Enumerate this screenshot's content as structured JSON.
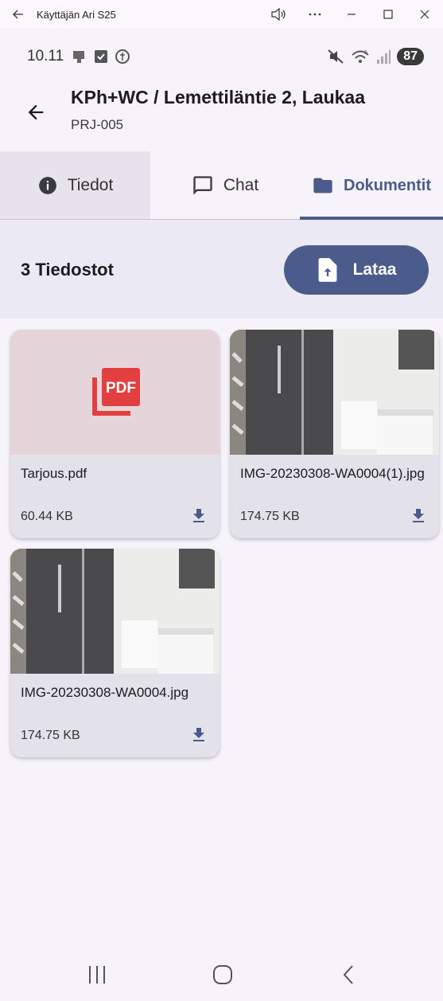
{
  "window": {
    "title": "Käyttäjän Ari S25",
    "icons": [
      "back-icon",
      "speaker-icon",
      "more-icon",
      "minimize-icon",
      "maximize-icon",
      "close-icon"
    ]
  },
  "status_bar": {
    "time": "10.11",
    "battery": "87",
    "signal_tag": "5"
  },
  "app_bar": {
    "title": "KPh+WC / Lemettiläntie 2, Laukaa",
    "subtitle": "PRJ-005"
  },
  "tabs": [
    {
      "label": "Tiedot",
      "icon": "info-icon"
    },
    {
      "label": "Chat",
      "icon": "chat-icon"
    },
    {
      "label": "Dokumentit",
      "icon": "folder-icon",
      "active": true
    }
  ],
  "toolbar": {
    "count_label": "3 Tiedostot",
    "upload_label": "Lataa"
  },
  "files": [
    {
      "name": "Tarjous.pdf",
      "size": "60.44 KB",
      "type": "pdf",
      "badge": "PDF"
    },
    {
      "name": "IMG-20230308-WA0004(1).jpg",
      "size": "174.75 KB",
      "type": "image"
    },
    {
      "name": "IMG-20230308-WA0004.jpg",
      "size": "174.75 KB",
      "type": "image"
    }
  ],
  "colors": {
    "accent": "#4a5b8c",
    "pdf_red": "#e24040",
    "background": "#f6f3fb"
  }
}
